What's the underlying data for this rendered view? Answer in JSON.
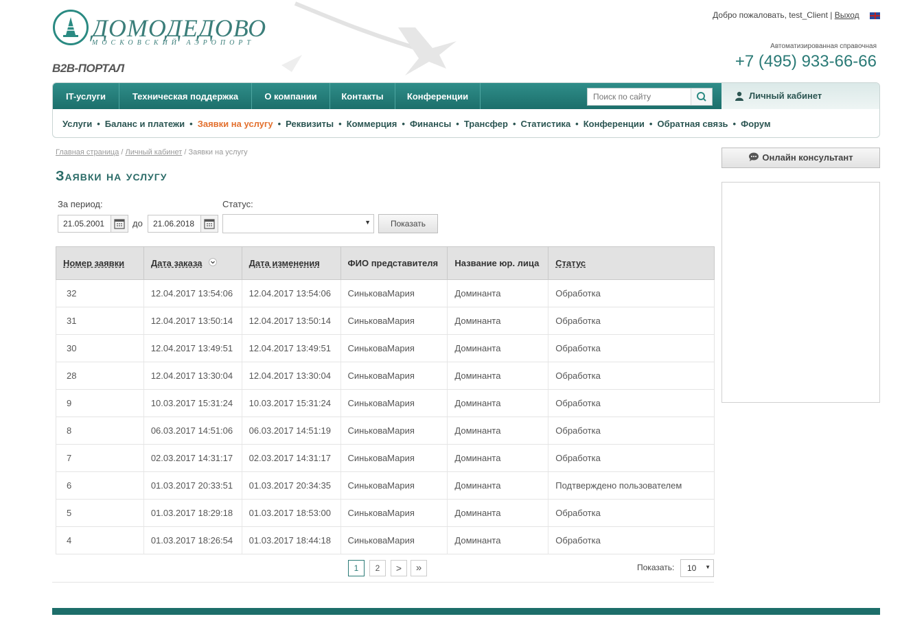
{
  "header": {
    "logo_title": "ДОМОДЕДОВО",
    "logo_subtitle": "МОСКОВСКИЙ АЭРОПОРТ",
    "portal_label": "B2B-ПОРТАЛ",
    "welcome_text": "Добро пожаловать, test_Client |",
    "logout_label": "Выход",
    "info_label": "Автоматизированная справочная",
    "phone": "+7 (495) 933-66-66"
  },
  "nav": {
    "main_items": [
      "IT-услуги",
      "Техническая поддержка",
      "О компании",
      "Контакты",
      "Конференции"
    ],
    "search_placeholder": "Поиск по сайту",
    "cabinet_label": "Личный кабинет",
    "sub_items": [
      "Услуги",
      "Баланс и платежи",
      "Заявки на услугу",
      "Реквизиты",
      "Коммерция",
      "Финансы",
      "Трансфер",
      "Статистика",
      "Конференции",
      "Обратная связь",
      "Форум"
    ],
    "active_sub_item": "Заявки на услугу"
  },
  "breadcrumb": {
    "items": [
      "Главная страница",
      "Личный кабинет"
    ],
    "current": "Заявки на услугу"
  },
  "page": {
    "title": "Заявки на услугу"
  },
  "filters": {
    "period_label": "За период:",
    "date_from": "21.05.2001",
    "to_label": "до",
    "date_to": "21.06.2018",
    "status_label": "Статус:",
    "status_value": "",
    "show_button": "Показать"
  },
  "table": {
    "columns": [
      "Номер заявки",
      "Дата заказа",
      "Дата изменения",
      "ФИО представителя",
      "Название юр. лица",
      "Статус"
    ],
    "rows": [
      [
        "32",
        "12.04.2017 13:54:06",
        "12.04.2017 13:54:06",
        "СиньковаМария",
        "Доминанта",
        "Обработка"
      ],
      [
        "31",
        "12.04.2017 13:50:14",
        "12.04.2017 13:50:14",
        "СиньковаМария",
        "Доминанта",
        "Обработка"
      ],
      [
        "30",
        "12.04.2017 13:49:51",
        "12.04.2017 13:49:51",
        "СиньковаМария",
        "Доминанта",
        "Обработка"
      ],
      [
        "28",
        "12.04.2017 13:30:04",
        "12.04.2017 13:30:04",
        "СиньковаМария",
        "Доминанта",
        "Обработка"
      ],
      [
        "9",
        "10.03.2017 15:31:24",
        "10.03.2017 15:31:24",
        "СиньковаМария",
        "Доминанта",
        "Обработка"
      ],
      [
        "8",
        "06.03.2017 14:51:06",
        "06.03.2017 14:51:19",
        "СиньковаМария",
        "Доминанта",
        "Обработка"
      ],
      [
        "7",
        "02.03.2017 14:31:17",
        "02.03.2017 14:31:17",
        "СиньковаМария",
        "Доминанта",
        "Обработка"
      ],
      [
        "6",
        "01.03.2017 20:33:51",
        "01.03.2017 20:34:35",
        "СиньковаМария",
        "Доминанта",
        "Подтверждено пользователем"
      ],
      [
        "5",
        "01.03.2017 18:29:18",
        "01.03.2017 18:53:00",
        "СиньковаМария",
        "Доминанта",
        "Обработка"
      ],
      [
        "4",
        "01.03.2017 18:26:54",
        "01.03.2017 18:44:18",
        "СиньковаМария",
        "Доминанта",
        "Обработка"
      ]
    ]
  },
  "pagination": {
    "pages": [
      "1",
      "2"
    ],
    "current_page": "1",
    "next_symbol": ">",
    "last_symbol": "»",
    "page_size_label": "Показать:",
    "page_size": "10"
  },
  "sidebar": {
    "consultant_button": "Онлайн консультант"
  },
  "colors": {
    "brand_teal": "#1d6e6a",
    "active_link": "#e3702e"
  }
}
